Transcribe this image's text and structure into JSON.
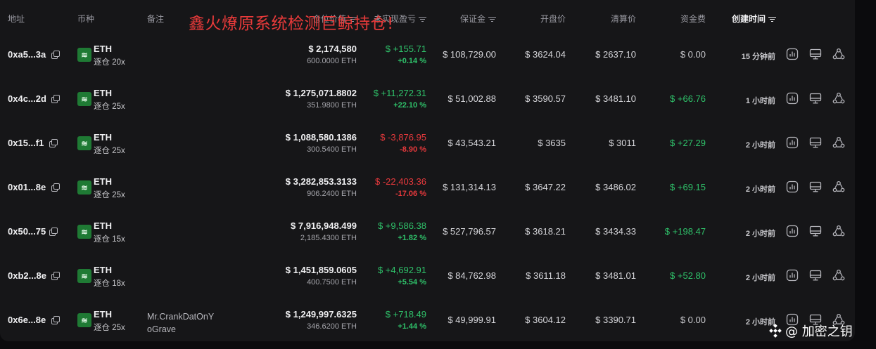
{
  "banner": "鑫火燎原系统检测巨鲸持仓!",
  "header": {
    "address": "地址",
    "coin": "币种",
    "note": "备注",
    "size": "仓位价值",
    "pnl": "未实现盈亏",
    "margin": "保证金",
    "entry": "开盘价",
    "liq": "清算价",
    "funding": "资金费",
    "created": "创建时间"
  },
  "colors": {
    "positive": "#2fc26a",
    "negative": "#e8393c",
    "accent": "#1f7a34"
  },
  "rows": [
    {
      "address": "0xa5...3a",
      "coin": "ETH",
      "leverage": "逐仓 20x",
      "note": "",
      "size": "$ 2,174,580",
      "amount": "600.0000 ETH",
      "pnl": "$ +155.71",
      "pnl_pct": "+0.14 %",
      "pnl_sign": "pos",
      "margin": "$ 108,729.00",
      "entry": "$ 3624.04",
      "liq": "$ 2637.10",
      "funding": "$ 0.00",
      "funding_sign": "neutral",
      "time": "15 分钟前"
    },
    {
      "address": "0x4c...2d",
      "coin": "ETH",
      "leverage": "逐仓 25x",
      "note": "",
      "size": "$ 1,275,071.8802",
      "amount": "351.9800 ETH",
      "pnl": "$ +11,272.31",
      "pnl_pct": "+22.10 %",
      "pnl_sign": "pos",
      "margin": "$ 51,002.88",
      "entry": "$ 3590.57",
      "liq": "$ 3481.10",
      "funding": "$ +66.76",
      "funding_sign": "pos",
      "time": "1 小时前"
    },
    {
      "address": "0x15...f1",
      "coin": "ETH",
      "leverage": "逐仓 25x",
      "note": "",
      "size": "$ 1,088,580.1386",
      "amount": "300.5400 ETH",
      "pnl": "$ -3,876.95",
      "pnl_pct": "-8.90 %",
      "pnl_sign": "neg",
      "margin": "$ 43,543.21",
      "entry": "$ 3635",
      "liq": "$ 3011",
      "funding": "$ +27.29",
      "funding_sign": "pos",
      "time": "2 小时前"
    },
    {
      "address": "0x01...8e",
      "coin": "ETH",
      "leverage": "逐仓 25x",
      "note": "",
      "size": "$ 3,282,853.3133",
      "amount": "906.2400 ETH",
      "pnl": "$ -22,403.36",
      "pnl_pct": "-17.06 %",
      "pnl_sign": "neg",
      "margin": "$ 131,314.13",
      "entry": "$ 3647.22",
      "liq": "$ 3486.02",
      "funding": "$ +69.15",
      "funding_sign": "pos",
      "time": "2 小时前"
    },
    {
      "address": "0x50...75",
      "coin": "ETH",
      "leverage": "逐仓 15x",
      "note": "",
      "size": "$ 7,916,948.499",
      "amount": "2,185.4300 ETH",
      "pnl": "$ +9,586.38",
      "pnl_pct": "+1.82 %",
      "pnl_sign": "pos",
      "margin": "$ 527,796.57",
      "entry": "$ 3618.21",
      "liq": "$ 3434.33",
      "funding": "$ +198.47",
      "funding_sign": "pos",
      "time": "2 小时前"
    },
    {
      "address": "0xb2...8e",
      "coin": "ETH",
      "leverage": "逐仓 18x",
      "note": "",
      "size": "$ 1,451,859.0605",
      "amount": "400.7500 ETH",
      "pnl": "$ +4,692.91",
      "pnl_pct": "+5.54 %",
      "pnl_sign": "pos",
      "margin": "$ 84,762.98",
      "entry": "$ 3611.18",
      "liq": "$ 3481.01",
      "funding": "$ +52.80",
      "funding_sign": "pos",
      "time": "2 小时前"
    },
    {
      "address": "0x6e...8e",
      "coin": "ETH",
      "leverage": "逐仓 25x",
      "note": "Mr.CrankDatOnY\noGrave",
      "size": "$ 1,249,997.6325",
      "amount": "346.6200 ETH",
      "pnl": "$ +718.49",
      "pnl_pct": "+1.44 %",
      "pnl_sign": "pos",
      "margin": "$ 49,999.91",
      "entry": "$ 3604.12",
      "liq": "$ 3390.71",
      "funding": "$ 0.00",
      "funding_sign": "neutral",
      "time": "2 小时前"
    }
  ],
  "watermark": "@ 加密之钥"
}
